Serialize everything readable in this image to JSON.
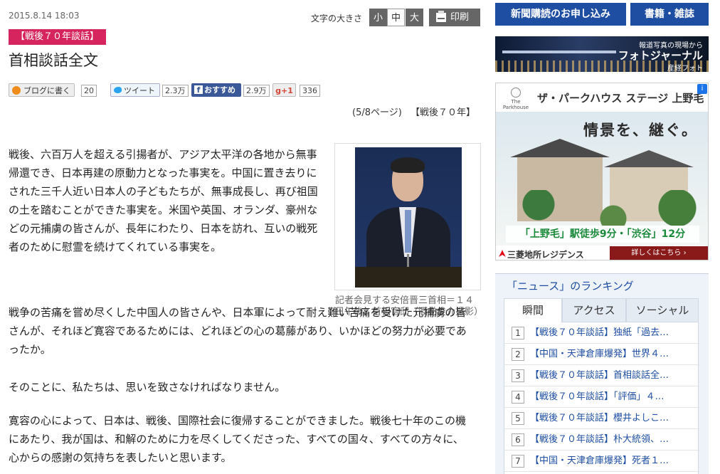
{
  "article": {
    "date": "2015.8.14 18:03",
    "fontsize_label": "文字の大きさ",
    "fontsize_small": "小",
    "fontsize_mid": "中",
    "fontsize_big": "大",
    "print_label": "印刷",
    "tag": "【戦後７０年談話】",
    "title": "首相談話全文",
    "page_info": "(5/8ページ)",
    "page_link": "【戦後７０年】",
    "photo_caption": "記者会見する安倍晋三首相＝１４日午後、首相官邸（酒巻俊介撮影）",
    "paragraphs": [
      "戦後、六百万人を超える引揚者が、アジア太平洋の各地から無事帰還でき、日本再建の原動力となった事実を。中国に置き去りにされた三千人近い日本人の子どもたちが、無事成長し、再び祖国の土を踏むことができた事実を。米国や英国、オランダ、豪州などの元捕虜の皆さんが、長年にわたり、日本を訪れ、互いの戦死者のために慰霊を続けてくれている事実を。",
      "戦争の苦痛を嘗め尽くした中国人の皆さんや、日本軍によって耐え難い苦痛を受けた元捕虜の皆さんが、それほど寛容であるためには、どれほどの心の葛藤があり、いかほどの努力が必要であったか。",
      "そのことに、私たちは、思いを致さなければなりません。",
      "寛容の心によって、日本は、戦後、国際社会に復帰することができました。戦後七十年のこの機にあたり、我が国は、和解のために力を尽くしてくださった、すべての国々、すべての方々に、心からの感謝の気持ちを表したいと思います。"
    ]
  },
  "social": {
    "blog_label": "ブログに書く",
    "blog_count": "20",
    "tweet_label": "ツイート",
    "tweet_count": "2.3万",
    "fb_label": "おすすめ",
    "fb_count": "2.9万",
    "gplus_label": "g+1",
    "gplus_count": "336"
  },
  "sidebar": {
    "subscribe_label": "新聞購読のお申し込み",
    "books_label": "書籍・雑誌",
    "photo_banner": {
      "sub": "報道写真の現場から",
      "main": "フォトジャーナル",
      "brand": "産経フォト"
    },
    "ad": {
      "logo_text": "The Parkhouse",
      "headline": "ザ・パークハウス ステージ 上野毛",
      "tagline": "情景を、継ぐ。",
      "access": "「上野毛」駅徒歩9分・「渋谷」12分",
      "company": "三菱地所レジデンス",
      "more": "詳しくはこちら ›"
    },
    "ranking": {
      "title": "「ニュース」のランキング",
      "tabs": [
        "瞬間",
        "アクセス",
        "ソーシャル"
      ],
      "items": [
        {
          "num": "1",
          "text": "【戦後７０年談話】独紙「過去…"
        },
        {
          "num": "2",
          "text": "【中国・天津倉庫爆発】世界４…"
        },
        {
          "num": "3",
          "text": "【戦後７０年談話】首相談話全…"
        },
        {
          "num": "4",
          "text": "【戦後７０年談話】「評価」４…"
        },
        {
          "num": "5",
          "text": "【戦後７０年談話】櫻井よしこ…"
        },
        {
          "num": "6",
          "text": "【戦後７０年談話】朴大統領、…"
        },
        {
          "num": "7",
          "text": "【中国・天津倉庫爆発】死者１…"
        }
      ]
    }
  }
}
